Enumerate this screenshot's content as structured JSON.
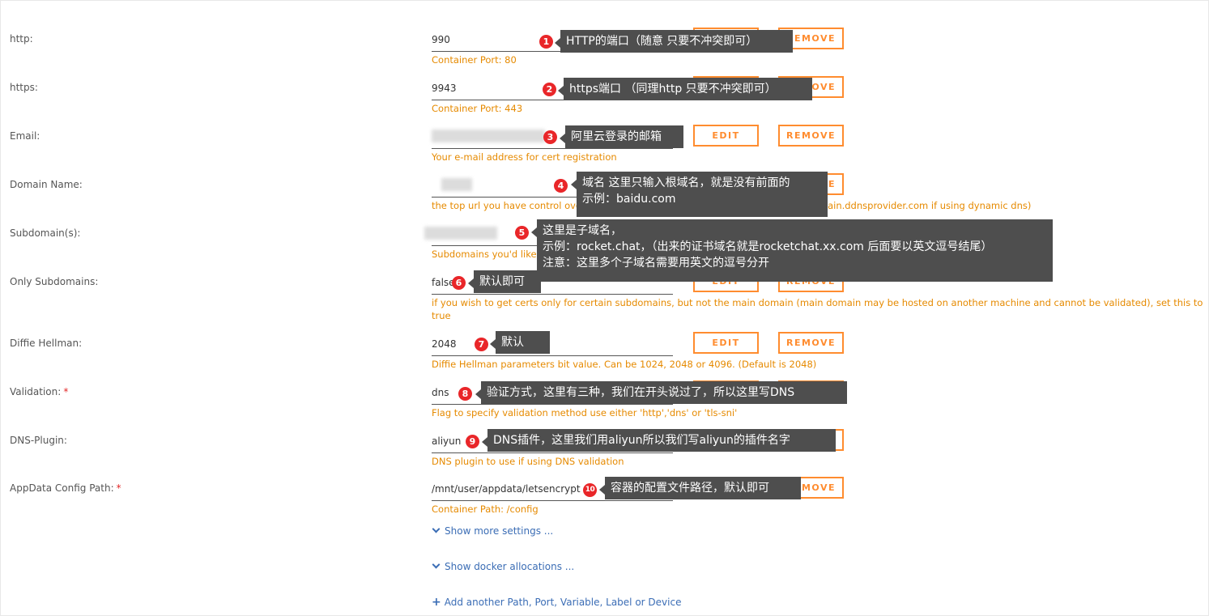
{
  "rows": [
    {
      "label": "http:",
      "value": "990",
      "desc": "Container Port: 80"
    },
    {
      "label": "https:",
      "value": "9943",
      "desc": "Container Port: 443"
    },
    {
      "label": "Email:",
      "value": "",
      "desc": "Your e-mail address for cert registration"
    },
    {
      "label": "Domain Name:",
      "value": "",
      "desc_a": "the top url you have control ove",
      "desc_b": "you own it, or customsubdomain.ddnsprovider.com if using dynamic dns)"
    },
    {
      "label": "Subdomain(s):",
      "value": "",
      "desc": "Subdomains you'd like"
    },
    {
      "label": "Only Subdomains:",
      "value": "false",
      "desc": "if you wish to get certs only for certain subdomains, but not the main domain (main domain may be hosted on another machine and cannot be validated), set this to true"
    },
    {
      "label": "Diffie Hellman:",
      "value": "2048",
      "desc": "Diffie Hellman parameters bit value. Can be 1024, 2048 or 4096. (Default is 2048)"
    },
    {
      "label": "Validation:",
      "required": "*",
      "value": "dns",
      "desc": "Flag to specify validation method use either 'http','dns' or 'tls-sni'"
    },
    {
      "label": "DNS-Plugin:",
      "value": "aliyun",
      "desc": "DNS plugin to use if using DNS validation"
    },
    {
      "label": "AppData Config Path:",
      "required": "*",
      "value": "/mnt/user/appdata/letsencrypt",
      "desc": "Container Path: /config"
    }
  ],
  "buttons": {
    "edit": "EDIT",
    "remove": "REMOVE"
  },
  "links": {
    "more_settings": "Show more settings ...",
    "docker_allocations": "Show docker allocations ...",
    "add_another": "Add another Path, Port, Variable, Label or Device"
  },
  "callouts": [
    {
      "num": "1",
      "lines": [
        "HTTP的端口（随意 只要不冲突即可）"
      ]
    },
    {
      "num": "2",
      "lines": [
        "https端口 （同理http 只要不冲突即可）"
      ]
    },
    {
      "num": "3",
      "lines": [
        "阿里云登录的邮箱"
      ]
    },
    {
      "num": "4",
      "lines": [
        "域名 这里只输入根域名，就是没有前面的",
        "示例：baidu.com"
      ]
    },
    {
      "num": "5",
      "lines": [
        "这里是子域名，",
        "示例：rocket.chat，（出来的证书域名就是rocketchat.xx.com 后面要以英文逗号结尾）",
        "注意：这里多个子域名需要用英文的逗号分开"
      ]
    },
    {
      "num": "6",
      "lines": [
        "默认即可"
      ]
    },
    {
      "num": "7",
      "lines": [
        "默认"
      ]
    },
    {
      "num": "8",
      "lines": [
        "验证方式，这里有三种，我们在开头说过了，所以这里写DNS"
      ]
    },
    {
      "num": "9",
      "lines": [
        "DNS插件，这里我们用aliyun所以我们写aliyun的插件名字"
      ]
    },
    {
      "num": "10",
      "lines": [
        "容器的配置文件路径，默认即可"
      ]
    }
  ],
  "colors": {
    "accent": "#ff8c2f",
    "desc": "#e68a00",
    "link": "#3b6db5",
    "callout_bg": "#4e4e4e",
    "badge": "#e92629"
  }
}
